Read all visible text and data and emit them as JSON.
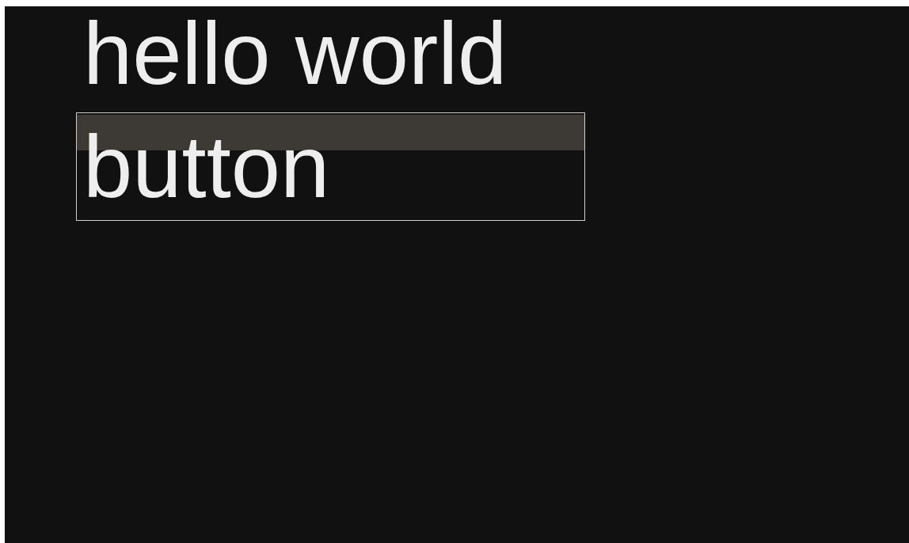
{
  "heading": "hello world",
  "button": {
    "label": "button"
  }
}
